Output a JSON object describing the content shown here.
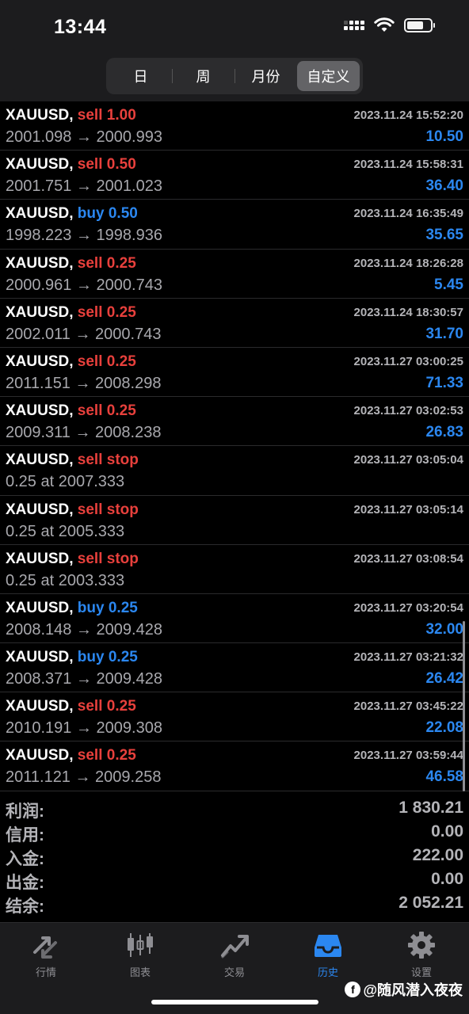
{
  "status": {
    "time": "13:44"
  },
  "segments": [
    "日",
    "周",
    "月份",
    "自定义"
  ],
  "trades": [
    {
      "symbol": "XAUUSD,",
      "type": "sell",
      "vol": "1.00",
      "side": "sell",
      "prices": "2001.098 → 2000.993",
      "time": "2023.11.24 15:52:20",
      "profit": "10.50"
    },
    {
      "symbol": "XAUUSD,",
      "type": "sell",
      "vol": "0.50",
      "side": "sell",
      "prices": "2001.751 → 2001.023",
      "time": "2023.11.24 15:58:31",
      "profit": "36.40"
    },
    {
      "symbol": "XAUUSD,",
      "type": "buy",
      "vol": "0.50",
      "side": "buy",
      "prices": "1998.223 → 1998.936",
      "time": "2023.11.24 16:35:49",
      "profit": "35.65"
    },
    {
      "symbol": "XAUUSD,",
      "type": "sell",
      "vol": "0.25",
      "side": "sell",
      "prices": "2000.961 → 2000.743",
      "time": "2023.11.24 18:26:28",
      "profit": "5.45"
    },
    {
      "symbol": "XAUUSD,",
      "type": "sell",
      "vol": "0.25",
      "side": "sell",
      "prices": "2002.011 → 2000.743",
      "time": "2023.11.24 18:30:57",
      "profit": "31.70"
    },
    {
      "symbol": "XAUUSD,",
      "type": "sell",
      "vol": "0.25",
      "side": "sell",
      "prices": "2011.151 → 2008.298",
      "time": "2023.11.27 03:00:25",
      "profit": "71.33"
    },
    {
      "symbol": "XAUUSD,",
      "type": "sell",
      "vol": "0.25",
      "side": "sell",
      "prices": "2009.311 → 2008.238",
      "time": "2023.11.27 03:02:53",
      "profit": "26.83"
    },
    {
      "symbol": "XAUUSD,",
      "type": "sell",
      "vol": "stop",
      "side": "sell",
      "prices": "0.25 at 2007.333",
      "time": "2023.11.27 03:05:04",
      "profit": ""
    },
    {
      "symbol": "XAUUSD,",
      "type": "sell",
      "vol": "stop",
      "side": "sell",
      "prices": "0.25 at 2005.333",
      "time": "2023.11.27 03:05:14",
      "profit": ""
    },
    {
      "symbol": "XAUUSD,",
      "type": "sell",
      "vol": "stop",
      "side": "sell",
      "prices": "0.25 at 2003.333",
      "time": "2023.11.27 03:08:54",
      "profit": ""
    },
    {
      "symbol": "XAUUSD,",
      "type": "buy",
      "vol": "0.25",
      "side": "buy",
      "prices": "2008.148 → 2009.428",
      "time": "2023.11.27 03:20:54",
      "profit": "32.00"
    },
    {
      "symbol": "XAUUSD,",
      "type": "buy",
      "vol": "0.25",
      "side": "buy",
      "prices": "2008.371 → 2009.428",
      "time": "2023.11.27 03:21:32",
      "profit": "26.42"
    },
    {
      "symbol": "XAUUSD,",
      "type": "sell",
      "vol": "0.25",
      "side": "sell",
      "prices": "2010.191 → 2009.308",
      "time": "2023.11.27 03:45:22",
      "profit": "22.08"
    },
    {
      "symbol": "XAUUSD,",
      "type": "sell",
      "vol": "0.25",
      "side": "sell",
      "prices": "2011.121 → 2009.258",
      "time": "2023.11.27 03:59:44",
      "profit": "46.58"
    }
  ],
  "summary": [
    {
      "label": "利润:",
      "value": "1 830.21"
    },
    {
      "label": "信用:",
      "value": "0.00"
    },
    {
      "label": "入金:",
      "value": "222.00"
    },
    {
      "label": "出金:",
      "value": "0.00"
    },
    {
      "label": "结余:",
      "value": "2 052.21"
    }
  ],
  "tabs": [
    {
      "label": "行情",
      "icon": "arrows-trade-icon"
    },
    {
      "label": "图表",
      "icon": "candlestick-chart-icon"
    },
    {
      "label": "交易",
      "icon": "trend-chart-icon"
    },
    {
      "label": "历史",
      "icon": "history-inbox-icon"
    },
    {
      "label": "设置",
      "icon": "gear-icon"
    }
  ],
  "watermark": "@随风潜入夜夜",
  "colors": {
    "sell": "#e8403c",
    "buy": "#2b87f0",
    "profit": "#2b87f0",
    "active_tab": "#2b87f0"
  }
}
